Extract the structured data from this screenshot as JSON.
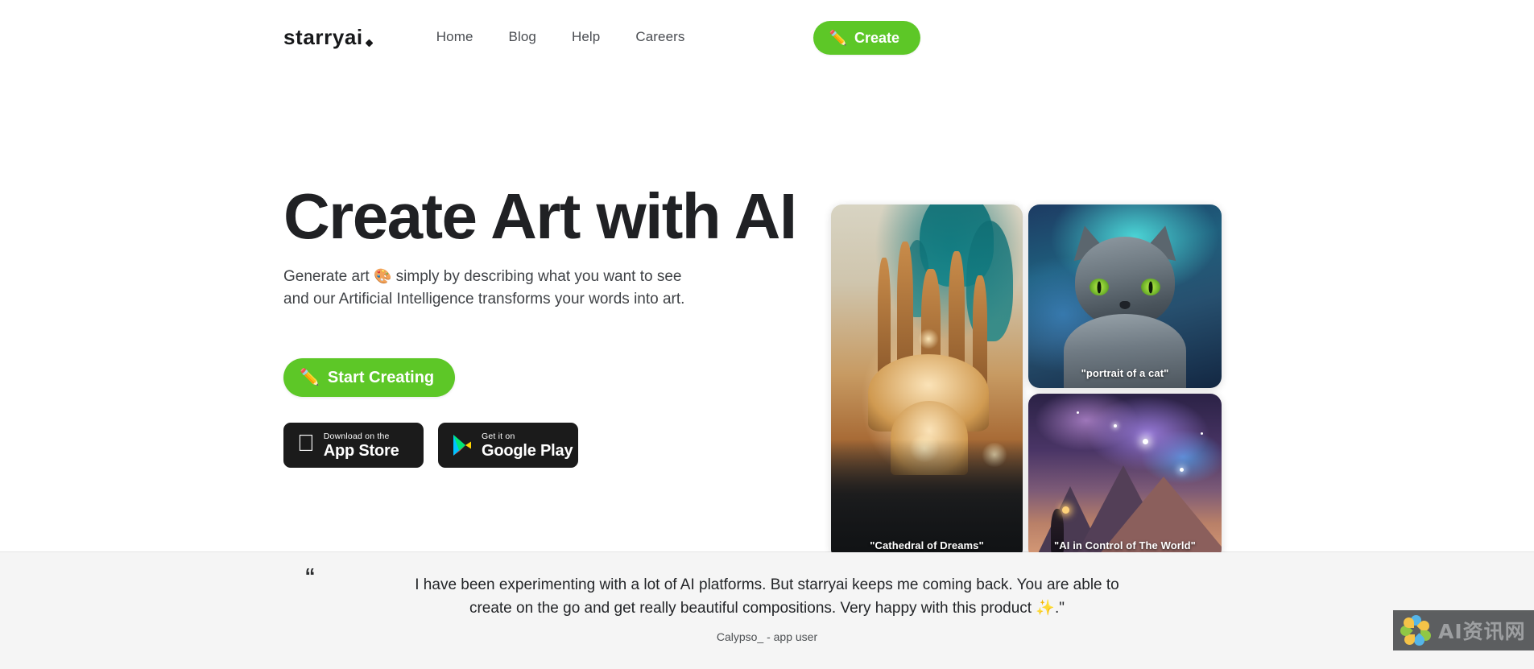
{
  "header": {
    "logo_text": "starryai",
    "nav": [
      {
        "label": "Home"
      },
      {
        "label": "Blog"
      },
      {
        "label": "Help"
      },
      {
        "label": "Careers"
      }
    ],
    "create_button": {
      "label": "Create",
      "icon": "pencil-emoji",
      "emoji": "✏️"
    }
  },
  "hero": {
    "title": "Create Art with AI",
    "subtitle_line1_before": "Generate art ",
    "subtitle_emoji": "🎨",
    "subtitle_line1_after": " simply by describing what you want to see",
    "subtitle_line2": "and our Artificial Intelligence transforms your words into art.",
    "start_button": {
      "label": "Start Creating",
      "icon": "pencil-emoji",
      "emoji": "✏️"
    },
    "store_badges": [
      {
        "small": "Download on the",
        "big": "App Store",
        "icon": "apple-logo-icon",
        "glyph": ""
      },
      {
        "small": "Get it on",
        "big": "Google Play",
        "icon": "google-play-icon"
      }
    ],
    "cards": [
      {
        "caption": "\"Cathedral of Dreams\"",
        "art": "cathedral"
      },
      {
        "caption": "\"portrait of a cat\"",
        "art": "cat"
      },
      {
        "caption": "\"AI in Control of The World\"",
        "art": "nebula"
      }
    ]
  },
  "testimonial": {
    "quote_mark": "“",
    "line1": "I have been experimenting with a lot of AI platforms. But starryai keeps me coming back. You are able to",
    "line2_before": "create on the go and get really beautiful compositions. Very happy with this product ",
    "line2_emoji": "✨",
    "line2_after": ".\"",
    "author": "Calypso_ - app user"
  },
  "watermark": {
    "text": "AI资讯网",
    "icon": "pinwheel-logo-icon"
  },
  "colors": {
    "accent_green": "#5dc727",
    "text_dark": "#202124",
    "text_body": "#3f4246",
    "badge_black": "#1b1b1b",
    "testimonial_bg": "#f5f5f5",
    "divider": "#e6e6e6"
  }
}
